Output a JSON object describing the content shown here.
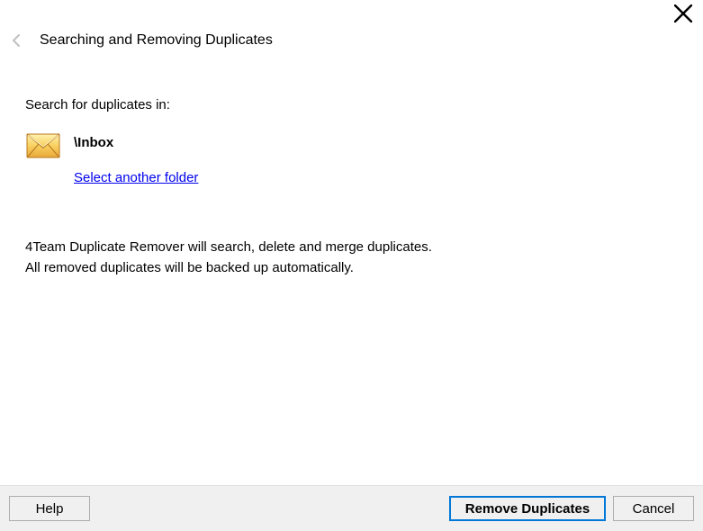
{
  "header": {
    "title": "Searching and Removing Duplicates"
  },
  "content": {
    "search_label": "Search for duplicates in:",
    "folder_name": "\\Inbox",
    "select_link": "Select another folder",
    "description_line1": "4Team Duplicate Remover will search, delete and merge duplicates.",
    "description_line2": "All removed duplicates will be backed up automatically."
  },
  "footer": {
    "help_label": "Help",
    "primary_label": "Remove Duplicates",
    "cancel_label": "Cancel"
  }
}
